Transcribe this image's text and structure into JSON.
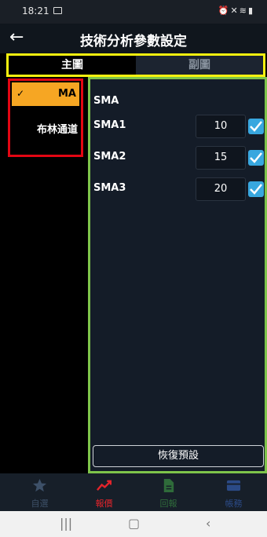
{
  "status_bar": {
    "time": "18:21"
  },
  "header": {
    "title": "技術分析參數設定"
  },
  "tabs": [
    {
      "label": "主圖"
    },
    {
      "label": "副圖"
    }
  ],
  "indicators": [
    {
      "label": "MA"
    },
    {
      "label": "布林通道"
    }
  ],
  "settings": {
    "section_title": "SMA",
    "rows": [
      {
        "label": "SMA1",
        "value": "10"
      },
      {
        "label": "SMA2",
        "value": "15"
      },
      {
        "label": "SMA3",
        "value": "20"
      }
    ],
    "reset_label": "恢復預設"
  },
  "bottom_nav": [
    {
      "label": "自選",
      "color": "#3d5068"
    },
    {
      "label": "報價",
      "color": "#e3242b"
    },
    {
      "label": "回報",
      "color": "#2f6b3a"
    },
    {
      "label": "帳務",
      "color": "#2b4a86"
    }
  ]
}
